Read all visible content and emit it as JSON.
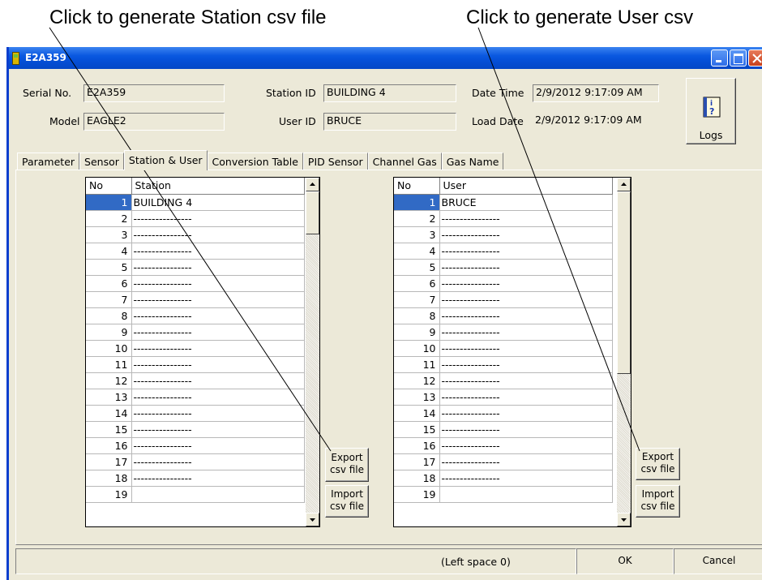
{
  "annotations": {
    "station": "Click to generate Station csv file",
    "user": "Click to generate User csv"
  },
  "window": {
    "title": "E2A359"
  },
  "info": {
    "serial_label": "Serial No.",
    "serial_value": "E2A359",
    "model_label": "Model",
    "model_value": "EAGLE2",
    "station_id_label": "Station ID",
    "station_id_value": "BUILDING 4",
    "user_id_label": "User ID",
    "user_id_value": "BRUCE",
    "date_time_label": "Date Time",
    "date_time_value": "2/9/2012 9:17:09 AM",
    "load_date_label": "Load Date",
    "load_date_value": "2/9/2012 9:17:09 AM",
    "logs_label": "Logs"
  },
  "tabs": [
    "Parameter",
    "Sensor",
    "Station & User",
    "Conversion Table",
    "PID Sensor",
    "Channel Gas",
    "Gas Name"
  ],
  "active_tab": "Station & User",
  "station_table": {
    "headers": [
      "No",
      "Station"
    ],
    "rows": [
      [
        "1",
        "BUILDING 4"
      ],
      [
        "2",
        "----------------"
      ],
      [
        "3",
        "----------------"
      ],
      [
        "4",
        "----------------"
      ],
      [
        "5",
        "----------------"
      ],
      [
        "6",
        "----------------"
      ],
      [
        "7",
        "----------------"
      ],
      [
        "8",
        "----------------"
      ],
      [
        "9",
        "----------------"
      ],
      [
        "10",
        "----------------"
      ],
      [
        "11",
        "----------------"
      ],
      [
        "12",
        "----------------"
      ],
      [
        "13",
        "----------------"
      ],
      [
        "14",
        "----------------"
      ],
      [
        "15",
        "----------------"
      ],
      [
        "16",
        "----------------"
      ],
      [
        "17",
        "----------------"
      ],
      [
        "18",
        "----------------"
      ],
      [
        "19",
        ""
      ]
    ]
  },
  "user_table": {
    "headers": [
      "No",
      "User"
    ],
    "rows": [
      [
        "1",
        "BRUCE"
      ],
      [
        "2",
        "----------------"
      ],
      [
        "3",
        "----------------"
      ],
      [
        "4",
        "----------------"
      ],
      [
        "5",
        "----------------"
      ],
      [
        "6",
        "----------------"
      ],
      [
        "7",
        "----------------"
      ],
      [
        "8",
        "----------------"
      ],
      [
        "9",
        "----------------"
      ],
      [
        "10",
        "----------------"
      ],
      [
        "11",
        "----------------"
      ],
      [
        "12",
        "----------------"
      ],
      [
        "13",
        "----------------"
      ],
      [
        "14",
        "----------------"
      ],
      [
        "15",
        "----------------"
      ],
      [
        "16",
        "----------------"
      ],
      [
        "17",
        "----------------"
      ],
      [
        "18",
        "----------------"
      ],
      [
        "19",
        ""
      ]
    ]
  },
  "buttons": {
    "export_line1": "Export",
    "export_line2": "csv file",
    "import_line1": "Import",
    "import_line2": "csv file",
    "ok": "OK",
    "cancel": "Cancel"
  },
  "status": {
    "left_space": "(Left space 0)"
  },
  "colors": {
    "titlebar": "#0550d8",
    "selection": "#316ac5",
    "window_bg": "#ece9d8"
  }
}
